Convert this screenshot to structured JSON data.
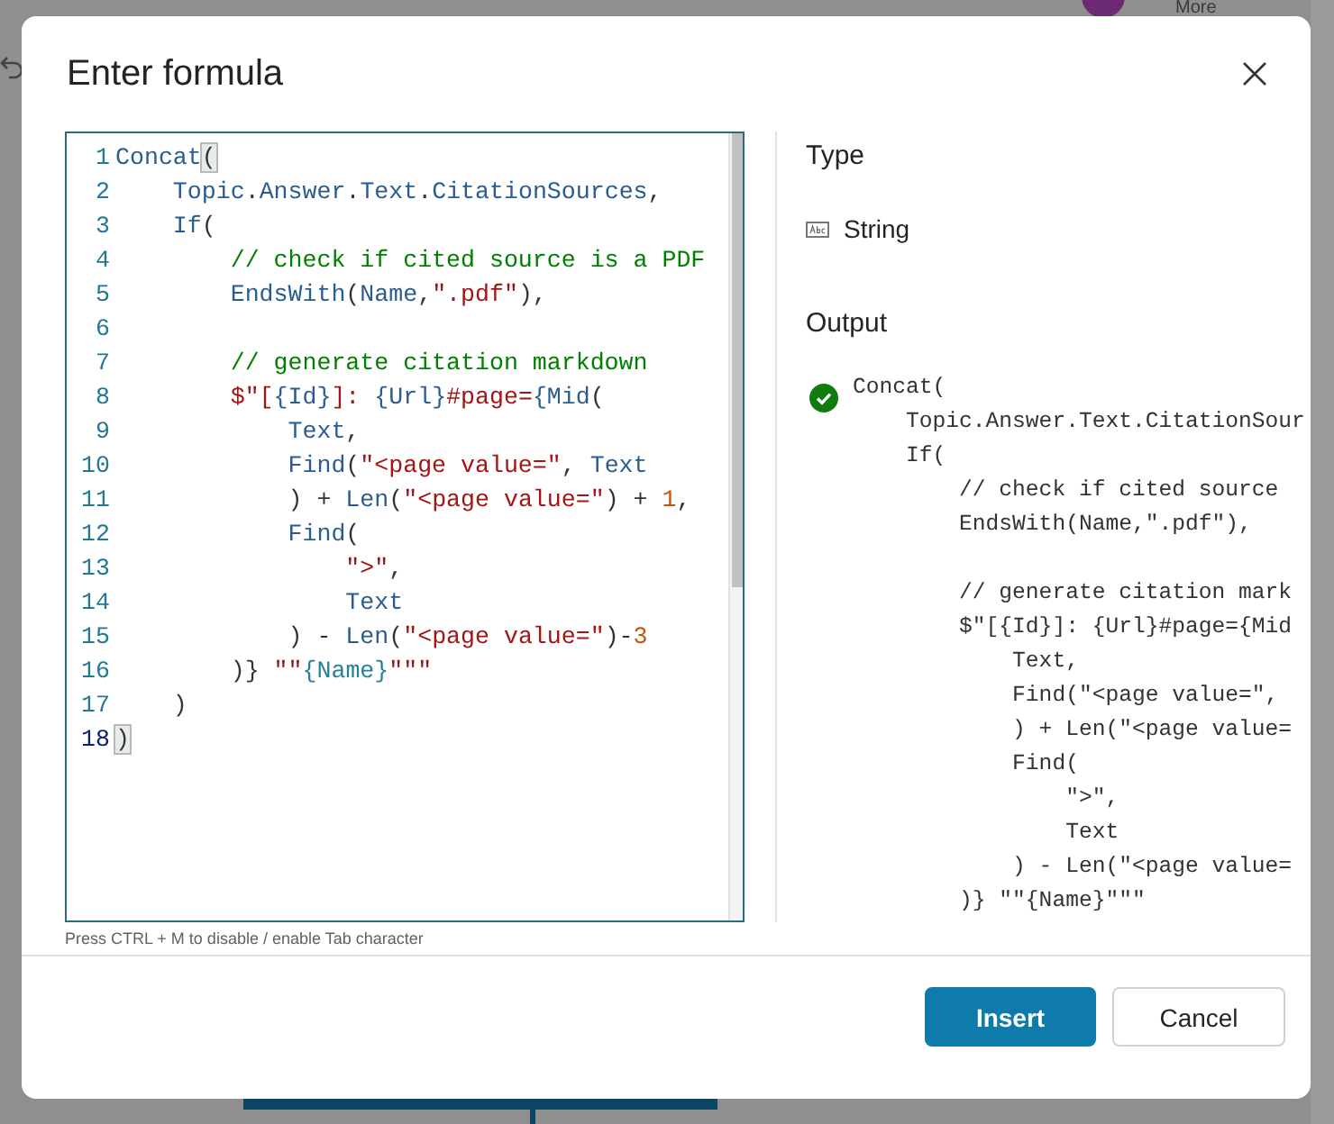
{
  "background": {
    "more_label": "More"
  },
  "dialog": {
    "title": "Enter formula",
    "editor": {
      "lines": [
        {
          "number": "1",
          "current": false,
          "tokens": [
            {
              "t": "Concat",
              "kind": "code"
            },
            {
              "t": "(",
              "kind": "match"
            }
          ]
        },
        {
          "number": "2",
          "current": false,
          "tokens": [
            {
              "t": "    Topic",
              "kind": "code"
            },
            {
              "t": ".",
              "kind": "plain"
            },
            {
              "t": "Answer",
              "kind": "code"
            },
            {
              "t": ".",
              "kind": "plain"
            },
            {
              "t": "Text",
              "kind": "code"
            },
            {
              "t": ".",
              "kind": "plain"
            },
            {
              "t": "CitationSources",
              "kind": "code"
            },
            {
              "t": ",",
              "kind": "plain"
            }
          ]
        },
        {
          "number": "3",
          "current": false,
          "tokens": [
            {
              "t": "    If",
              "kind": "code"
            },
            {
              "t": "(",
              "kind": "plain"
            }
          ]
        },
        {
          "number": "4",
          "current": false,
          "tokens": [
            {
              "t": "        // check if cited source is a PDF",
              "kind": "comment"
            }
          ]
        },
        {
          "number": "5",
          "current": false,
          "tokens": [
            {
              "t": "        EndsWith",
              "kind": "code"
            },
            {
              "t": "(",
              "kind": "plain"
            },
            {
              "t": "Name",
              "kind": "code"
            },
            {
              "t": ",",
              "kind": "plain"
            },
            {
              "t": "\".pdf\"",
              "kind": "str"
            },
            {
              "t": "),",
              "kind": "plain"
            }
          ]
        },
        {
          "number": "6",
          "current": false
        },
        {
          "number": "7",
          "current": false,
          "tokens": [
            {
              "t": "        // generate citation markdown",
              "kind": "comment"
            }
          ]
        },
        {
          "number": "8",
          "current": false,
          "tokens": [
            {
              "t": "        $\"[",
              "kind": "str"
            },
            {
              "t": "{Id}",
              "kind": "code"
            },
            {
              "t": "]: ",
              "kind": "str"
            },
            {
              "t": "{Url}",
              "kind": "code"
            },
            {
              "t": "#page=",
              "kind": "str"
            },
            {
              "t": "{Mid",
              "kind": "code"
            },
            {
              "t": "(",
              "kind": "plain"
            }
          ]
        },
        {
          "number": "9",
          "current": false,
          "tokens": [
            {
              "t": "            Text",
              "kind": "code"
            },
            {
              "t": ",",
              "kind": "plain"
            }
          ]
        },
        {
          "number": "10",
          "current": false,
          "tokens": [
            {
              "t": "            Find",
              "kind": "code"
            },
            {
              "t": "(",
              "kind": "plain"
            },
            {
              "t": "\"<page value=\"",
              "kind": "str"
            },
            {
              "t": ", ",
              "kind": "plain"
            },
            {
              "t": "Text",
              "kind": "code"
            }
          ]
        },
        {
          "number": "11",
          "current": false,
          "tokens": [
            {
              "t": "            ) + ",
              "kind": "plain"
            },
            {
              "t": "Len",
              "kind": "code"
            },
            {
              "t": "(",
              "kind": "plain"
            },
            {
              "t": "\"<page value=\"",
              "kind": "str"
            },
            {
              "t": ") + ",
              "kind": "plain"
            },
            {
              "t": "1",
              "kind": "num"
            },
            {
              "t": ",",
              "kind": "plain"
            }
          ]
        },
        {
          "number": "12",
          "current": false,
          "tokens": [
            {
              "t": "            Find",
              "kind": "code"
            },
            {
              "t": "(",
              "kind": "plain"
            }
          ]
        },
        {
          "number": "13",
          "current": false,
          "tokens": [
            {
              "t": "                \">\"",
              "kind": "str"
            },
            {
              "t": ",",
              "kind": "plain"
            }
          ]
        },
        {
          "number": "14",
          "current": false,
          "tokens": [
            {
              "t": "                Text",
              "kind": "code"
            }
          ]
        },
        {
          "number": "15",
          "current": false,
          "tokens": [
            {
              "t": "            ) - ",
              "kind": "plain"
            },
            {
              "t": "Len",
              "kind": "code"
            },
            {
              "t": "(",
              "kind": "plain"
            },
            {
              "t": "\"<page value=\"",
              "kind": "str"
            },
            {
              "t": ")-",
              "kind": "plain"
            },
            {
              "t": "3",
              "kind": "num"
            }
          ]
        },
        {
          "number": "16",
          "current": false,
          "tokens": [
            {
              "t": "        )} ",
              "kind": "plain"
            },
            {
              "t": "\"\"",
              "kind": "str"
            },
            {
              "t": "{Name}",
              "kind": "interp"
            },
            {
              "t": "\"\"\"",
              "kind": "str"
            }
          ]
        },
        {
          "number": "17",
          "current": false,
          "tokens": [
            {
              "t": "    )",
              "kind": "plain"
            }
          ]
        },
        {
          "number": "18",
          "current": true,
          "tokens": [
            {
              "t": ")",
              "kind": "match"
            }
          ]
        }
      ],
      "hint": "Press CTRL + M to disable / enable Tab character"
    },
    "type": {
      "heading": "Type",
      "value": "String"
    },
    "output": {
      "heading": "Output",
      "valid": true,
      "blocks": [
        [
          "Concat(",
          "    Topic.Answer.Text.CitationSour",
          "    If(",
          "        // check if cited source",
          "        EndsWith(Name,\".pdf\"),"
        ],
        [
          "        // generate citation mark",
          "        $\"[{Id}]: {Url}#page={Mid",
          "            Text,",
          "            Find(\"<page value=\",",
          "            ) + Len(\"<page value=",
          "            Find(",
          "                \">\",",
          "                Text",
          "            ) - Len(\"<page value=",
          "        )} \"\"{Name}\"\"\""
        ]
      ]
    },
    "buttons": [
      {
        "label": "Insert",
        "kind": "primary"
      },
      {
        "label": "Cancel",
        "kind": "secondary"
      }
    ]
  }
}
